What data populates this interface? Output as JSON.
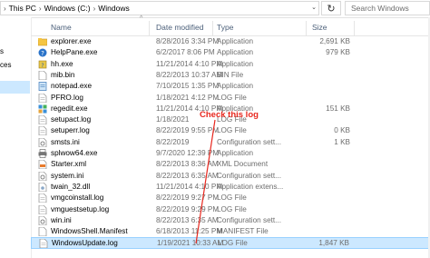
{
  "address": {
    "crumbs": [
      "This PC",
      "Windows (C:)",
      "Windows"
    ],
    "search_placeholder": "Search Windows"
  },
  "nav": {
    "items": [
      "s",
      "ces"
    ]
  },
  "columns": {
    "name": "Name",
    "date": "Date modified",
    "type": "Type",
    "size": "Size"
  },
  "files": [
    {
      "name": "explorer.exe",
      "date": "8/28/2016 3:34 PM",
      "type": "Application",
      "size": "2,691 KB",
      "icon": "folder-app-icon"
    },
    {
      "name": "HelpPane.exe",
      "date": "6/2/2017 8:06 PM",
      "type": "Application",
      "size": "979 KB",
      "icon": "help-icon"
    },
    {
      "name": "hh.exe",
      "date": "11/21/2014 4:10 PM",
      "type": "Application",
      "size": "",
      "icon": "help-book-icon"
    },
    {
      "name": "mib.bin",
      "date": "8/22/2013 10:37 AM",
      "type": "BIN File",
      "size": "",
      "icon": "file-icon"
    },
    {
      "name": "notepad.exe",
      "date": "7/10/2015 1:35 PM",
      "type": "Application",
      "size": "",
      "icon": "notepad-icon"
    },
    {
      "name": "PFRO.log",
      "date": "1/18/2021 4:12 PM",
      "type": "LOG File",
      "size": "",
      "icon": "text-file-icon"
    },
    {
      "name": "regedit.exe",
      "date": "11/21/2014 4:10 PM",
      "type": "Application",
      "size": "151 KB",
      "icon": "registry-icon"
    },
    {
      "name": "setupact.log",
      "date": "1/18/2021",
      "type": "LOG File",
      "size": "",
      "icon": "text-file-icon"
    },
    {
      "name": "setuperr.log",
      "date": "8/22/2019 9:55 PM",
      "type": "LOG File",
      "size": "0 KB",
      "icon": "text-file-icon"
    },
    {
      "name": "smsts.ini",
      "date": "8/22/2019",
      "type": "Configuration sett...",
      "size": "1 KB",
      "icon": "settings-file-icon"
    },
    {
      "name": "splwow64.exe",
      "date": "9/7/2020 12:39 PM",
      "type": "Application",
      "size": "",
      "icon": "printer-icon"
    },
    {
      "name": "Starter.xml",
      "date": "8/22/2013 8:36 AM",
      "type": "XML Document",
      "size": "",
      "icon": "xml-file-icon"
    },
    {
      "name": "system.ini",
      "date": "8/22/2013 6:35 AM",
      "type": "Configuration sett...",
      "size": "",
      "icon": "settings-file-icon"
    },
    {
      "name": "twain_32.dll",
      "date": "11/21/2014 4:10 PM",
      "type": "Application extens...",
      "size": "",
      "icon": "dll-file-icon"
    },
    {
      "name": "vmgcoinstall.log",
      "date": "8/22/2019 9:27 PM",
      "type": "LOG File",
      "size": "",
      "icon": "text-file-icon"
    },
    {
      "name": "vmguestsetup.log",
      "date": "8/22/2019 9:29 PM",
      "type": "LOG File",
      "size": "",
      "icon": "text-file-icon"
    },
    {
      "name": "win.ini",
      "date": "8/22/2013 6:35 AM",
      "type": "Configuration sett...",
      "size": "",
      "icon": "settings-file-icon"
    },
    {
      "name": "WindowsShell.Manifest",
      "date": "6/18/2013 11:25 PM",
      "type": "MANIFEST File",
      "size": "",
      "icon": "file-icon"
    },
    {
      "name": "WindowsUpdate.log",
      "date": "1/19/2021 10:33 AM",
      "type": "LOG File",
      "size": "1,847 KB",
      "icon": "text-file-icon",
      "selected": true
    }
  ],
  "annotation": {
    "text": "Check this log",
    "color": "#e8281f"
  },
  "colors": {
    "selection": "#cce8ff",
    "header_text": "#4c607a",
    "detail_text": "#6d6d6d"
  }
}
